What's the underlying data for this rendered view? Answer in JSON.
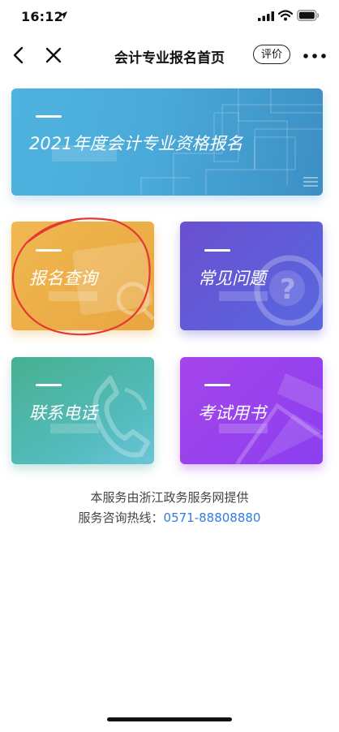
{
  "status_bar": {
    "time": "16:12"
  },
  "nav": {
    "title": "会计专业报名首页",
    "rate_label": "评价"
  },
  "cards": {
    "banner": {
      "label": "2021年度会计专业资格报名"
    },
    "query": {
      "label": "报名查询"
    },
    "faq": {
      "label": "常见问题"
    },
    "contact": {
      "label": "联系电话"
    },
    "books": {
      "label": "考试用书"
    }
  },
  "footer": {
    "provider": "本服务由浙江政务服务网提供",
    "hotline_label": "服务咨询热线：",
    "hotline_number": "0571-88808880"
  },
  "colors": {
    "accent_link": "#2f7de1",
    "annotation_circle": "#e53935"
  }
}
